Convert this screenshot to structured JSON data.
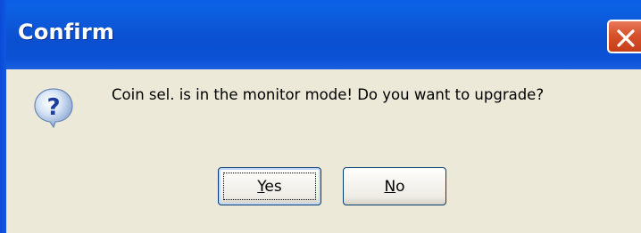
{
  "dialog": {
    "title": "Confirm",
    "message": "Coin sel. is in the monitor mode! Do you want to upgrade?",
    "icon": "question-icon"
  },
  "buttons": {
    "yes": {
      "accel": "Y",
      "rest": "es"
    },
    "no": {
      "accel": "N",
      "rest": "o"
    }
  },
  "colors": {
    "titlebar": "#0a52d6",
    "client": "#ece9d8",
    "close": "#d5522c"
  }
}
